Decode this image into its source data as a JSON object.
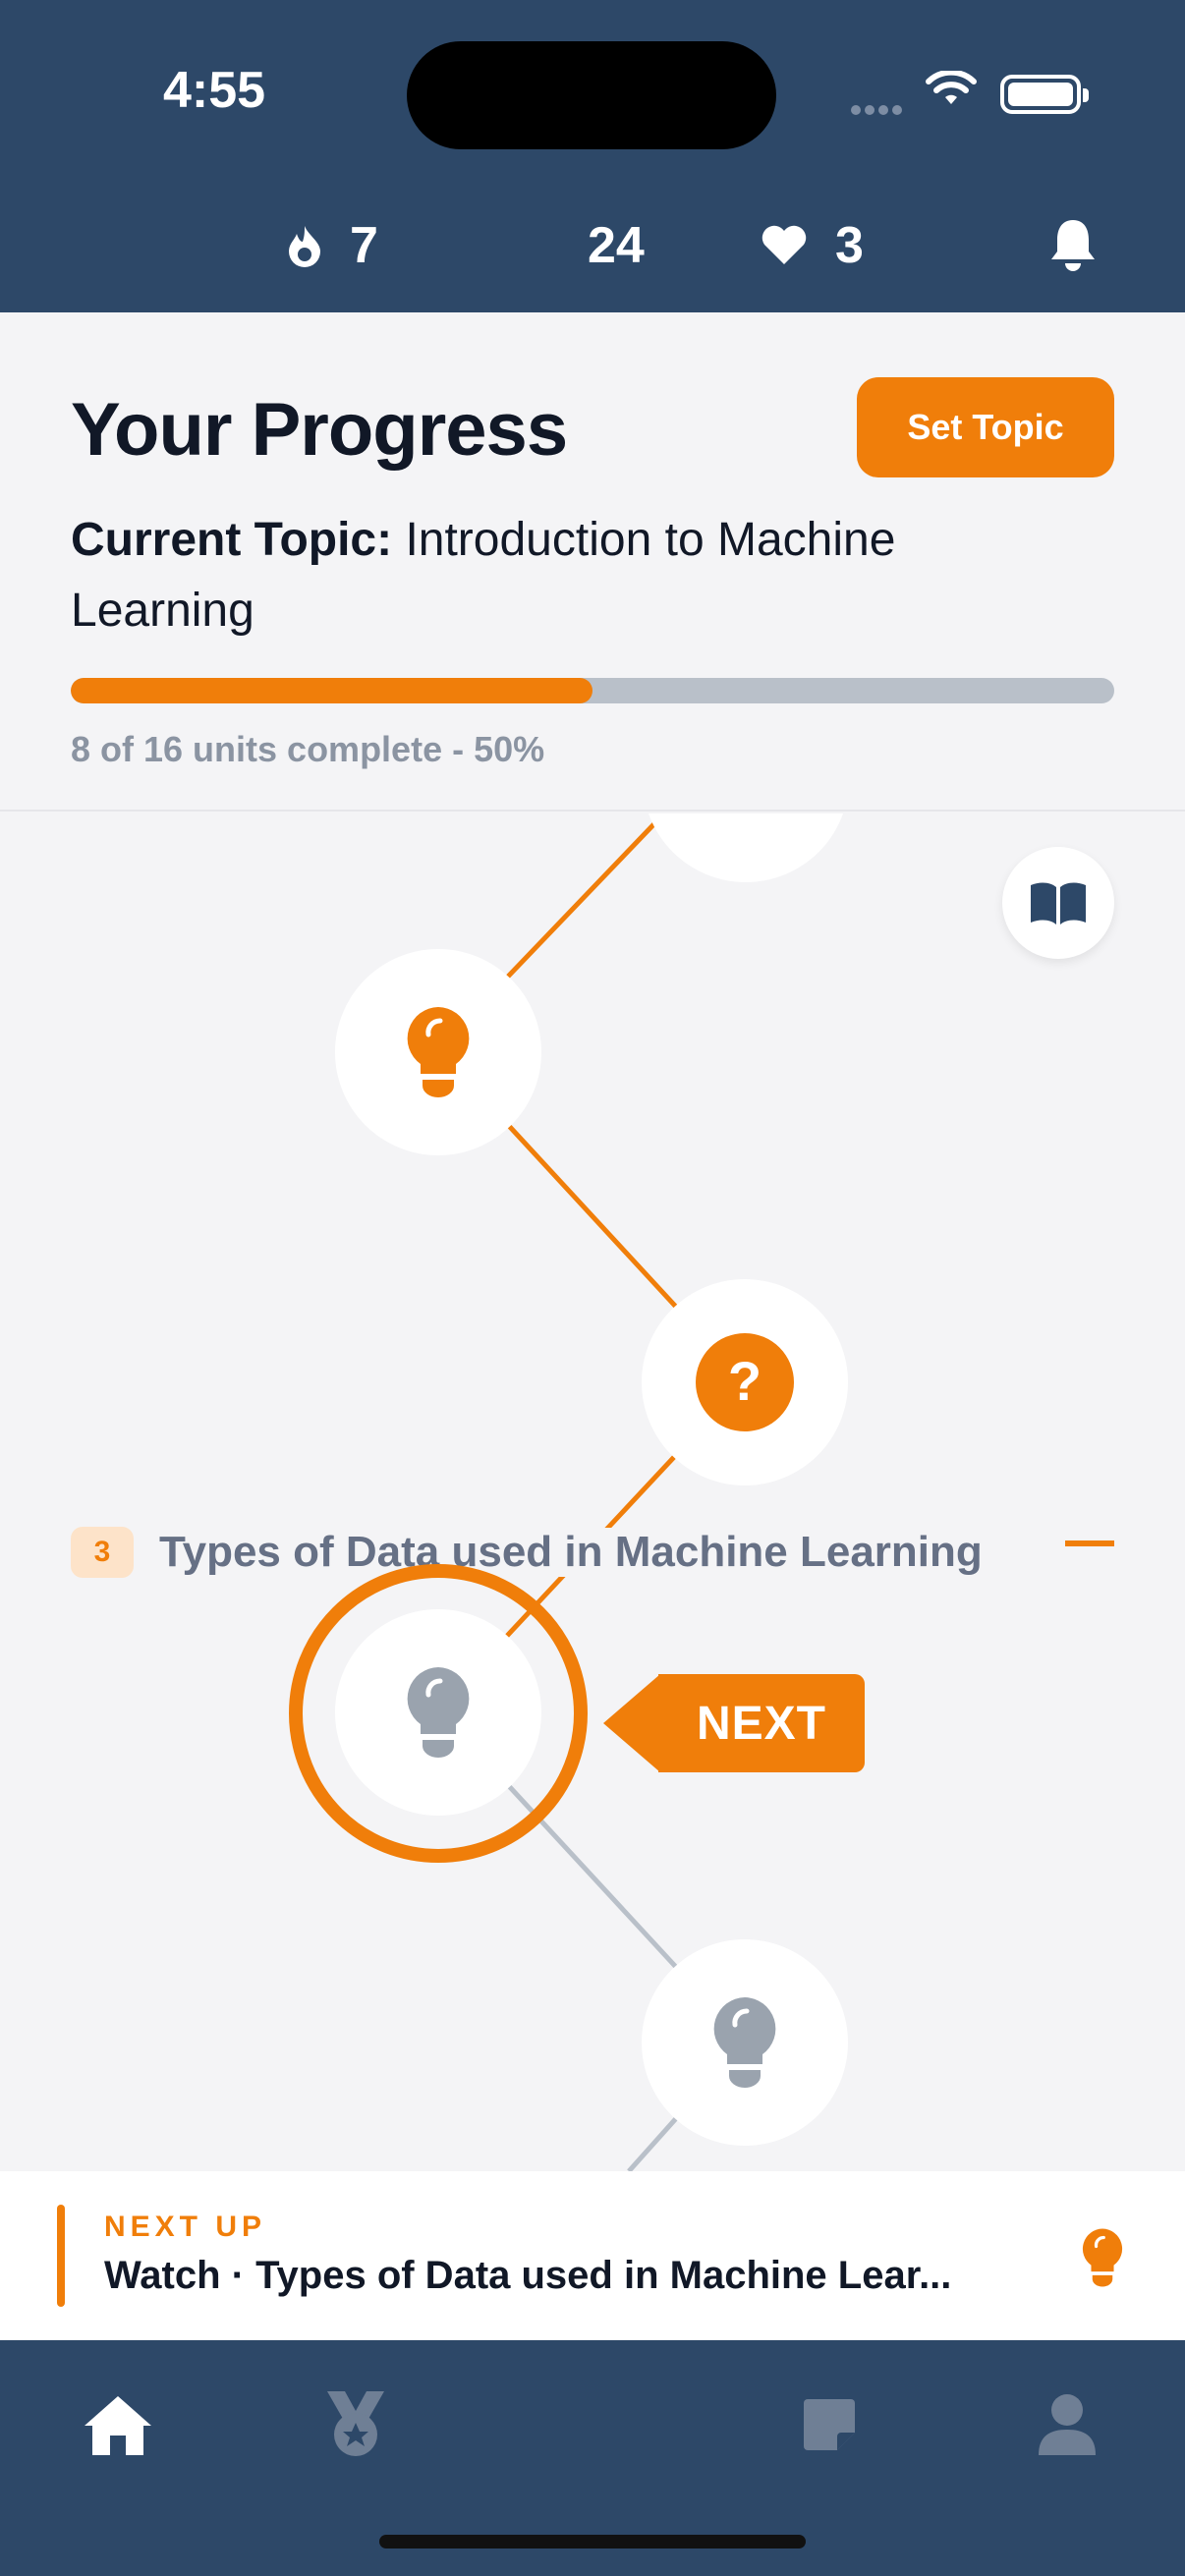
{
  "status_bar": {
    "time": "4:55"
  },
  "stats": {
    "streak": "7",
    "xp": "24",
    "lives": "3"
  },
  "progress": {
    "title": "Your Progress",
    "set_topic_label": "Set Topic",
    "current_topic_label": "Current Topic:",
    "current_topic_value": "Introduction to Machine Learning",
    "units_text": "8 of 16 units complete - 50%",
    "percent": 50
  },
  "path": {
    "section_number": "3",
    "section_title": "Types of Data used in Machine Learning",
    "next_badge": "NEXT"
  },
  "next_up": {
    "kicker": "NEXT UP",
    "text": "Watch · Types of Data used in Machine Lear..."
  },
  "colors": {
    "accent": "#f07e0a",
    "navy": "#2d4868",
    "locked": "#9aa3ae"
  },
  "icons": [
    "flame-icon",
    "bolt-icon",
    "heart-icon",
    "bell-icon",
    "book-icon",
    "lightbulb-icon",
    "question-icon",
    "home-icon",
    "medal-icon",
    "notes-icon",
    "profile-icon"
  ]
}
